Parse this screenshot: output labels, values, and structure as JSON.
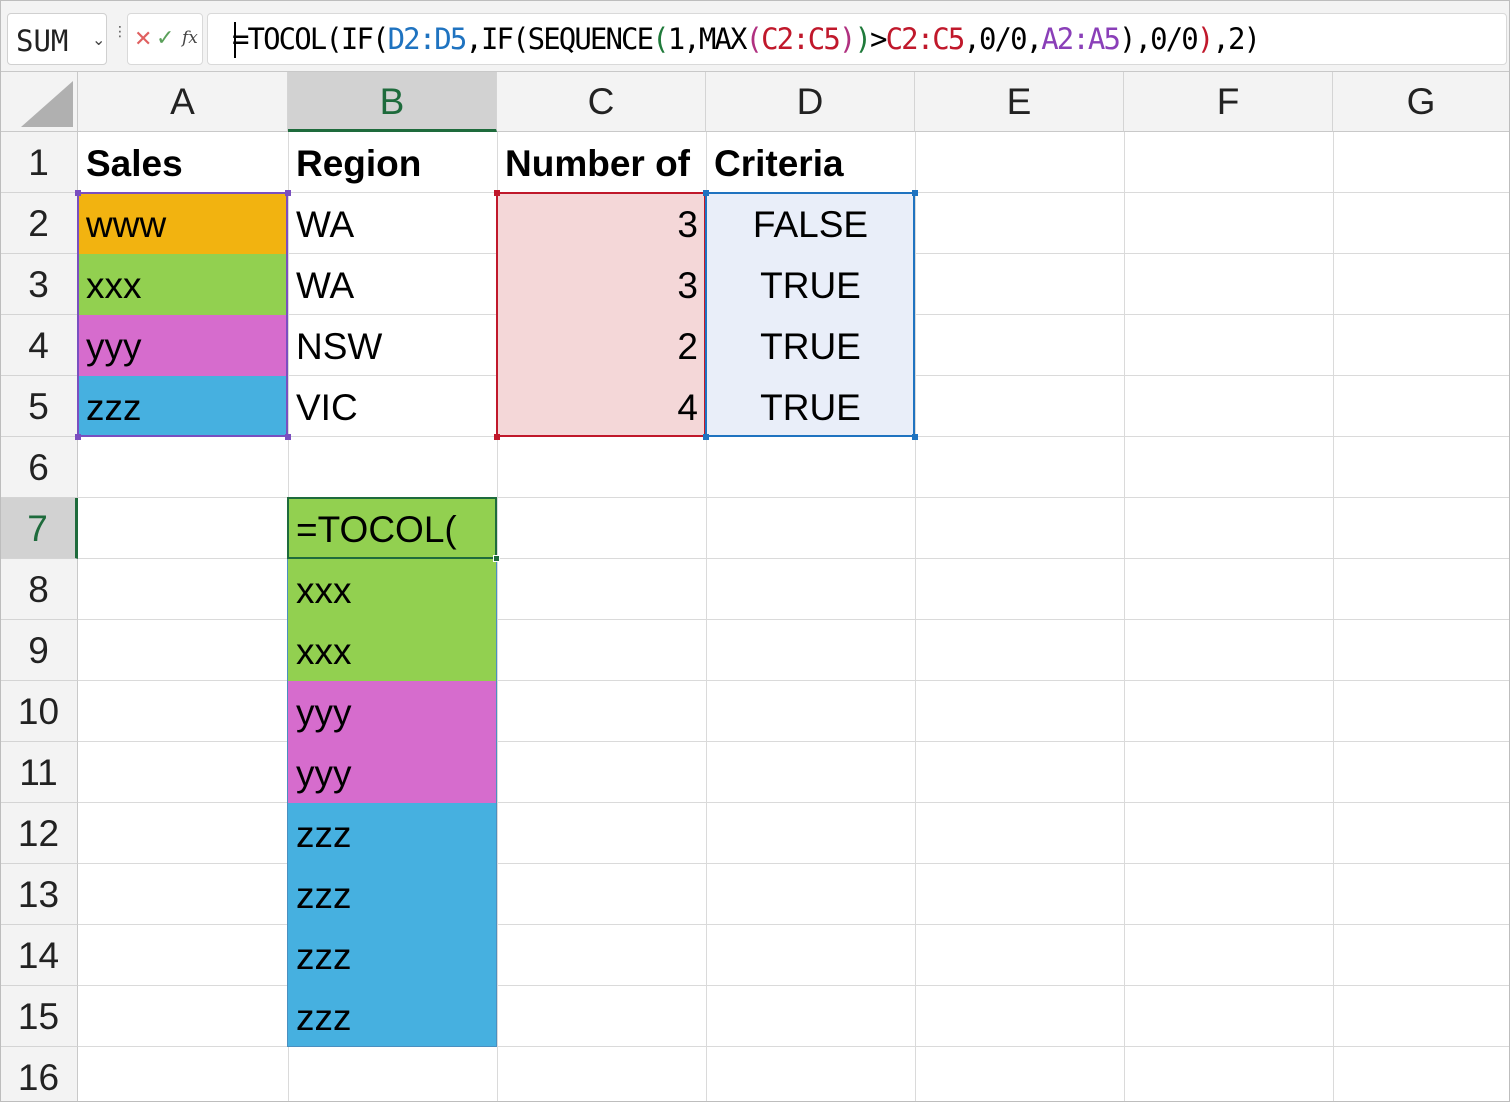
{
  "formula_bar": {
    "name_box": "SUM",
    "formula_segments": [
      {
        "text": "=TOCOL(IF(",
        "color": "plain"
      },
      {
        "text": "D2:D5",
        "color": "blue"
      },
      {
        "text": ",IF(",
        "color": "plain"
      },
      {
        "text": "SEQUENCE",
        "color": "plain"
      },
      {
        "text": "(",
        "color": "green"
      },
      {
        "text": "1,MAX",
        "color": "plain"
      },
      {
        "text": "(",
        "color": "magenta"
      },
      {
        "text": "C2:C5",
        "color": "red"
      },
      {
        "text": ")",
        "color": "magenta"
      },
      {
        "text": ")",
        "color": "green"
      },
      {
        "text": ">",
        "color": "plain"
      },
      {
        "text": "C2:C5",
        "color": "red"
      },
      {
        "text": ",0/0,",
        "color": "plain"
      },
      {
        "text": "A2:A5",
        "color": "violet"
      },
      {
        "text": ")",
        "color": "plain"
      },
      {
        "text": ",0/0",
        "color": "plain"
      },
      {
        "text": ")",
        "color": "red"
      },
      {
        "text": ",2)",
        "color": "plain"
      }
    ]
  },
  "columns": [
    "A",
    "B",
    "C",
    "D",
    "E",
    "F",
    "G"
  ],
  "selected_column": "B",
  "rows": [
    "1",
    "2",
    "3",
    "4",
    "5",
    "6",
    "7",
    "8",
    "9",
    "10",
    "11",
    "12",
    "13",
    "14",
    "15",
    "16"
  ],
  "selected_row": "7",
  "headers": {
    "A1": "Sales",
    "B1": "Region",
    "C1": "Number of",
    "D1": "Criteria"
  },
  "table": {
    "sales": [
      "www",
      "xxx",
      "yyy",
      "zzz"
    ],
    "region": [
      "WA",
      "WA",
      "NSW",
      "VIC"
    ],
    "number": [
      "3",
      "3",
      "2",
      "4"
    ],
    "criteria": [
      "FALSE",
      "TRUE",
      "TRUE",
      "TRUE"
    ]
  },
  "active_cell_text": "=TOCOL(",
  "spill": [
    "xxx",
    "xxx",
    "yyy",
    "yyy",
    "zzz",
    "zzz",
    "zzz",
    "zzz"
  ],
  "colors": {
    "www": "#f2b310",
    "xxx": "#92d050",
    "yyy": "#d66ccd",
    "zzz": "#46b0e0",
    "number_fill": "#f4d7d8",
    "criteria_fill": "#e9eef9",
    "range_A": "#7a4fc0",
    "range_C": "#c0182b",
    "range_D": "#1f73c0",
    "active": "#1e6b3c"
  }
}
